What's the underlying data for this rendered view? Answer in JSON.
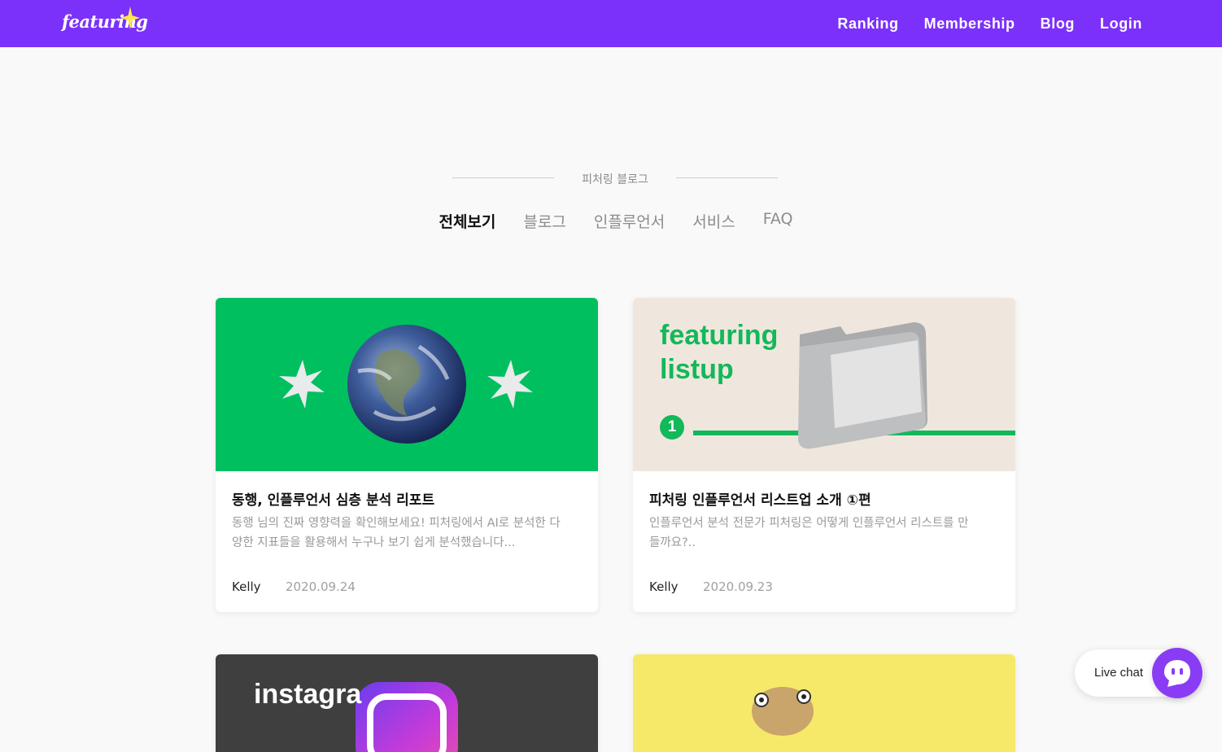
{
  "header": {
    "logo_text": "featuring",
    "nav": [
      "Ranking",
      "Membership",
      "Blog",
      "Login"
    ],
    "brand_color": "#7b31fa"
  },
  "section": {
    "label": "피처링 블로그"
  },
  "tabs": [
    {
      "label": "전체보기",
      "active": true
    },
    {
      "label": "블로그",
      "active": false
    },
    {
      "label": "인플루언서",
      "active": false
    },
    {
      "label": "서비스",
      "active": false
    },
    {
      "label": "FAQ",
      "active": false
    }
  ],
  "cards": [
    {
      "title": "동행, 인플루언서 심층 분석 리포트",
      "desc_line1": "동행 님의 진짜 영향력을 확인해보세요! 피처링에서 AI로 분석한 다",
      "desc_line2": "양한 지표들을 활용해서 누구나 보기 쉽게 분석했습니다...",
      "author": "Kelly",
      "date": "2020.09.24",
      "thumb_color": "#00bf5f"
    },
    {
      "title": "피처링 인플루언서 리스트업 소개 ①편",
      "desc_line1": "인플루언서 분석 전문가 피처링은 어떻게 인플루언서 리스트를 만",
      "desc_line2": "들까요?..",
      "author": "Kelly",
      "date": "2020.09.23",
      "thumb_color": "#efe7dd",
      "thumb_text_line1": "featuring",
      "thumb_text_line2": "listup",
      "thumb_badge": "1"
    },
    {
      "thumb_color": "#3f3f3f",
      "thumb_text": "instagra"
    },
    {
      "thumb_color": "#f6e96a"
    }
  ],
  "livechat": {
    "label": "Live chat",
    "icon": "chat-bubble-icon"
  }
}
